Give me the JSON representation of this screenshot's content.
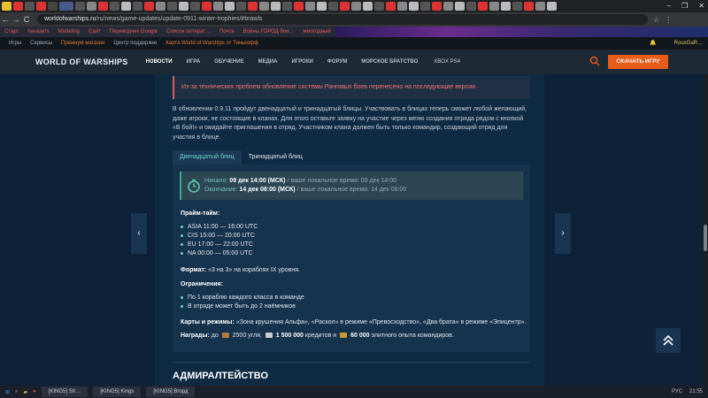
{
  "browser": {
    "url_host": "worldofwarships.ru",
    "url_path": "/ru/news/game-updates/update-0911-winter-trophies/#brawls",
    "window_controls": [
      "–",
      "❐",
      "✕"
    ],
    "nav": {
      "back": "←",
      "forward": "→",
      "reload": "C"
    }
  },
  "bookmarks": [
    "Старт",
    "navalarts",
    "Modeling",
    "Сайт",
    "Переводчик Google",
    "Список литерат…",
    "Почта",
    "Войны ГОРОД бои…",
    "ммогодный"
  ],
  "portal_bar": {
    "items": [
      "Игры",
      "Сервисы",
      "Премиум магазин",
      "Центр поддержки",
      "Карта World of Warships от Тинькофф"
    ],
    "user": "RouxGaR…"
  },
  "main_nav": {
    "logo": "WORLD OF WARSHIPS",
    "items": [
      "НОВОСТИ",
      "ИГРА",
      "ОБУЧЕНИЕ",
      "МЕДИА",
      "ИГРОКИ",
      "ФОРУМ",
      "МОРСКОЕ БРАТСТВО"
    ],
    "platforms": "XBOX  PS4",
    "play_button": "СКАЧАТЬ ИГРУ"
  },
  "article": {
    "notice": "Из-за технических проблем обновление системы Ранговых боев перенесено на последующие версии.",
    "intro": "В обновлении 0.9.11 пройдут двенадцатый и тринадцатый блицы. Участвовать в блицах теперь сможет любой желающий, даже игроки, не состоящие в кланах. Для этого оставьте заявку на участие через меню создания отряда рядом с кнопкой «В бой!» и ожидайте приглашения в отряд. Участником клана должен быть только командир, создающий отряд для участия в блице.",
    "tabs": [
      "Двенадцатый блиц",
      "Тринадцатый блиц"
    ],
    "start_label": "Начало:",
    "start_value": "09 дек 14:00 (МСК)",
    "start_local": "/ ваше локальное время: 09 дек 14:00",
    "end_label": "Окончание:",
    "end_value": "14 дек 08:00 (МСК)",
    "end_local": "/ ваше локальное время: 14 дек 08:00",
    "prime_title": "Прайм-тайм:",
    "prime_times": [
      "ASIA 11:00 — 16:00 UTC",
      "CIS 15:00 — 20:00 UTC",
      "EU 17:00 — 22:00 UTC",
      "NA 00:00 — 05:00 UTC"
    ],
    "format_label": "Формат:",
    "format_text": "«3 на 3» на кораблях IX уровня.",
    "limits_title": "Ограничения:",
    "limits": [
      "По 1 кораблю каждого класса в команде",
      "В отряде может быть до 2 наёмников"
    ],
    "maps_label": "Карты и режимы:",
    "maps_text": "«Зона крушения Альфа», «Раскол» в режиме «Превосходство», «Два брата» в режиме «Эпицентр».",
    "rewards_label": "Награды:",
    "rewards_prefix": "до",
    "coal": "2500 угля,",
    "credits": "1 500 000",
    "credits_suffix": "кредитов и",
    "xp": "60 000",
    "xp_suffix": "элитного опыта командиров.",
    "next_section": "АДМИРАЛТЕЙСТВО"
  },
  "taskbar": {
    "tasks": [
      "[KING5] Str…",
      "[KING5] Kings",
      "[KING5] Вгорд"
    ],
    "lang": "РУС",
    "time": "21:55"
  },
  "colors": {
    "accent": "#e75b1b",
    "notice": "#f17272",
    "teal": "#6fd1c9"
  }
}
